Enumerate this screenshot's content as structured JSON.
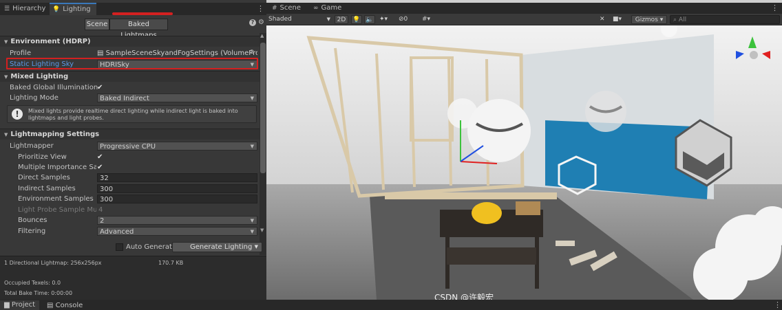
{
  "left_panel": {
    "tabs": [
      {
        "label": "Hierarchy",
        "icon": "list-icon"
      },
      {
        "label": "Lighting",
        "icon": "bulb-icon"
      }
    ],
    "segments": [
      "Scene",
      "Baked Lightmaps"
    ],
    "environment": {
      "header": "Environment (HDRP)",
      "profile_label": "Profile",
      "profile_value": "SampleSceneSkyandFogSettings (VolumeProfi",
      "static_sky_label": "Static Lighting Sky",
      "static_sky_value": "HDRISky"
    },
    "mixed": {
      "header": "Mixed Lighting",
      "baked_gi_label": "Baked Global Illumination",
      "mode_label": "Lighting Mode",
      "mode_value": "Baked Indirect",
      "info": "Mixed lights provide realtime direct lighting while indirect light is baked into lightmaps and light probes."
    },
    "lightmapping": {
      "header": "Lightmapping Settings",
      "lightmapper_label": "Lightmapper",
      "lightmapper_value": "Progressive CPU",
      "prioritize_label": "Prioritize View",
      "mis_label": "Multiple Importance Samp",
      "direct_label": "Direct Samples",
      "direct_value": "32",
      "indirect_label": "Indirect Samples",
      "indirect_value": "300",
      "env_label": "Environment Samples",
      "env_value": "300",
      "probe_label": "Light Probe Sample Multip",
      "probe_value": "4",
      "bounces_label": "Bounces",
      "bounces_value": "2",
      "filtering_label": "Filtering",
      "filtering_value": "Advanced"
    },
    "auto_generate": "Auto Generate",
    "generate_button": "Generate Lighting",
    "stats": {
      "lightmap": "1 Directional Lightmap: 256x256px",
      "size": "170.7 KB",
      "texels": "Occupied Texels: 0.0",
      "bake_time": "Total Bake Time: 0:00:00"
    }
  },
  "scene_panel": {
    "tabs": [
      {
        "label": "Scene",
        "icon": "grid-icon"
      },
      {
        "label": "Game",
        "icon": "gamepad-icon"
      }
    ],
    "shading_mode": "Shaded",
    "toggle_2d": "2D",
    "hidden_count": "0",
    "gizmos": "Gizmos",
    "search_placeholder": "All"
  },
  "bottom_tabs": [
    "Project",
    "Console"
  ],
  "watermark": "CSDN @许毅宏",
  "colors": {
    "highlight": "#d42020",
    "accent": "#3a79bb",
    "link_label": "#5a9ae6"
  }
}
